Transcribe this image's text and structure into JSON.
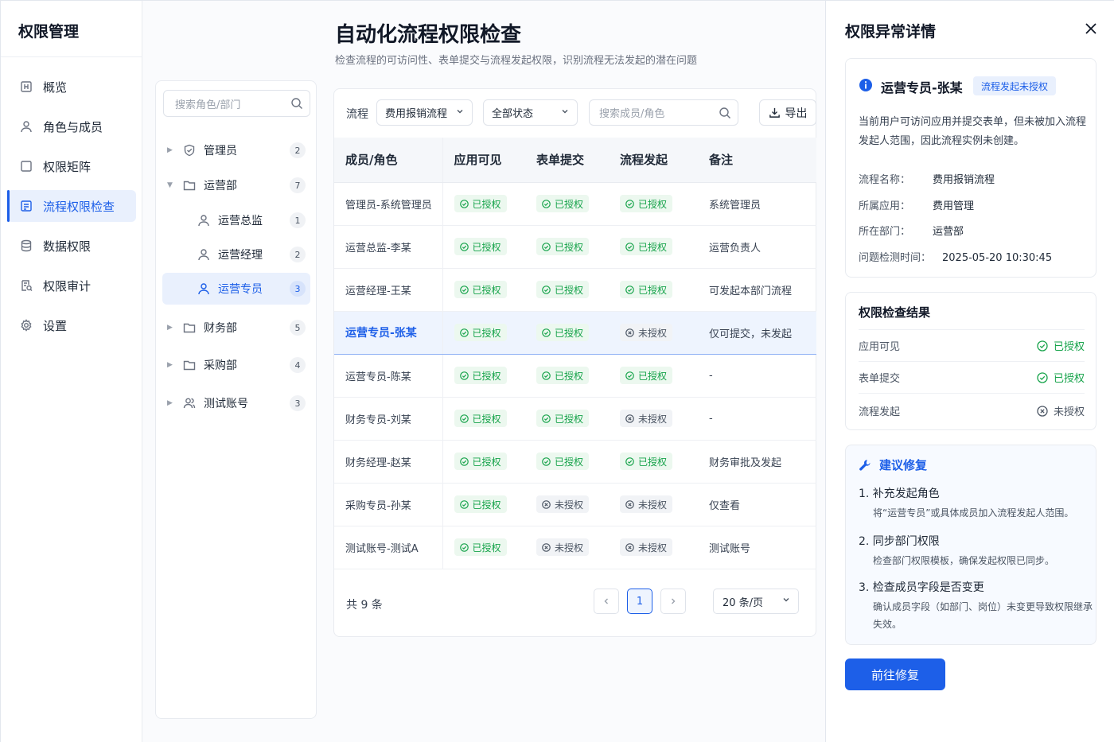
{
  "sidebar": {
    "title": "权限管理",
    "items": [
      {
        "label": "概览",
        "icon": "overview-icon"
      },
      {
        "label": "角色与成员",
        "icon": "user-icon"
      },
      {
        "label": "权限矩阵",
        "icon": "matrix-icon"
      },
      {
        "label": "流程权限检查",
        "icon": "flow-check-icon",
        "active": true
      },
      {
        "label": "数据权限",
        "icon": "database-icon"
      },
      {
        "label": "权限审计",
        "icon": "audit-icon"
      },
      {
        "label": "设置",
        "icon": "gear-icon"
      }
    ]
  },
  "header": {
    "title": "自动化流程权限检查",
    "subtitle": "检查流程的可访问性、表单提交与流程发起权限，识别流程无法发起的潜在问题"
  },
  "tree": {
    "search_placeholder": "搜索角色/部门",
    "nodes": [
      {
        "label": "管理员",
        "count": "2"
      },
      {
        "label": "运营部",
        "count": "7"
      },
      {
        "label": "运营总监",
        "count": "1"
      },
      {
        "label": "运营经理",
        "count": "2"
      },
      {
        "label": "运营专员",
        "count": "3"
      },
      {
        "label": "财务部",
        "count": "5"
      },
      {
        "label": "采购部",
        "count": "4"
      },
      {
        "label": "测试账号",
        "count": "3"
      }
    ]
  },
  "filters": {
    "label": "流程",
    "process_value": "费用报销流程",
    "status_value": "全部状态",
    "search_placeholder": "搜索成员/角色",
    "export_label": "导出"
  },
  "table": {
    "headers": [
      "成员/角色",
      "应用可见",
      "表单提交",
      "流程发起",
      "备注"
    ],
    "ok_label": "已授权",
    "no_label": "未授权",
    "rows": [
      {
        "name": "管理员-系统管理员",
        "visible": "已授权",
        "submit": "已授权",
        "start": "已授权",
        "note": "系统管理员"
      },
      {
        "name": "运营总监-李某",
        "visible": "已授权",
        "submit": "已授权",
        "start": "已授权",
        "note": "运营负责人"
      },
      {
        "name": "运营经理-王某",
        "visible": "已授权",
        "submit": "已授权",
        "start": "已授权",
        "note": "可发起本部门流程"
      },
      {
        "name": "运营专员-张某",
        "visible": "已授权",
        "submit": "已授权",
        "start": "未授权",
        "note": "仅可提交，未发起"
      },
      {
        "name": "运营专员-陈某",
        "visible": "已授权",
        "submit": "已授权",
        "start": "已授权",
        "note": "-"
      },
      {
        "name": "财务专员-刘某",
        "visible": "已授权",
        "submit": "已授权",
        "start": "未授权",
        "note": "-"
      },
      {
        "name": "财务经理-赵某",
        "visible": "已授权",
        "submit": "已授权",
        "start": "已授权",
        "note": "财务审批及发起"
      },
      {
        "name": "采购专员-孙某",
        "visible": "已授权",
        "submit": "未授权",
        "start": "未授权",
        "note": "仅查看"
      },
      {
        "name": "测试账号-测试A",
        "visible": "已授权",
        "submit": "未授权",
        "start": "未授权",
        "note": "测试账号"
      }
    ]
  },
  "pagination": {
    "total": "共 9 条",
    "current_page": "1",
    "page_size": "20 条/页"
  },
  "drawer": {
    "title": "权限异常详情",
    "member": "运营专员-张某",
    "tag": "流程发起未授权",
    "description": "当前用户可访问应用并提交表单，但未被加入流程发起人范围，因此流程实例未创建。",
    "fields": [
      {
        "key": "流程名称：",
        "value": "费用报销流程"
      },
      {
        "key": "所属应用：",
        "value": "费用管理"
      },
      {
        "key": "所在部门：",
        "value": "运营部"
      },
      {
        "key": "问题检测时间：",
        "value": "2025-05-20 10:30:45"
      }
    ],
    "result_title": "权限检查结果",
    "results": [
      {
        "label": "应用可见",
        "status": "已授权"
      },
      {
        "label": "表单提交",
        "status": "已授权"
      },
      {
        "label": "流程发起",
        "status": "未授权"
      }
    ],
    "fix_title": "建议修复",
    "steps": [
      {
        "title": "1.  补充发起角色",
        "detail": "将“运营专员”或具体成员加入流程发起人范围。"
      },
      {
        "title": "2.  同步部门权限",
        "detail": "检查部门权限模板，确保发起权限已同步。"
      },
      {
        "title": "3.  检查成员字段是否变更",
        "detail": "确认成员字段（如部门、岗位）未变更导致权限继承失效。"
      }
    ],
    "fix_button": "前往修复"
  },
  "colors": {
    "accent": "#1d5fe8",
    "success": "#16a34a"
  }
}
